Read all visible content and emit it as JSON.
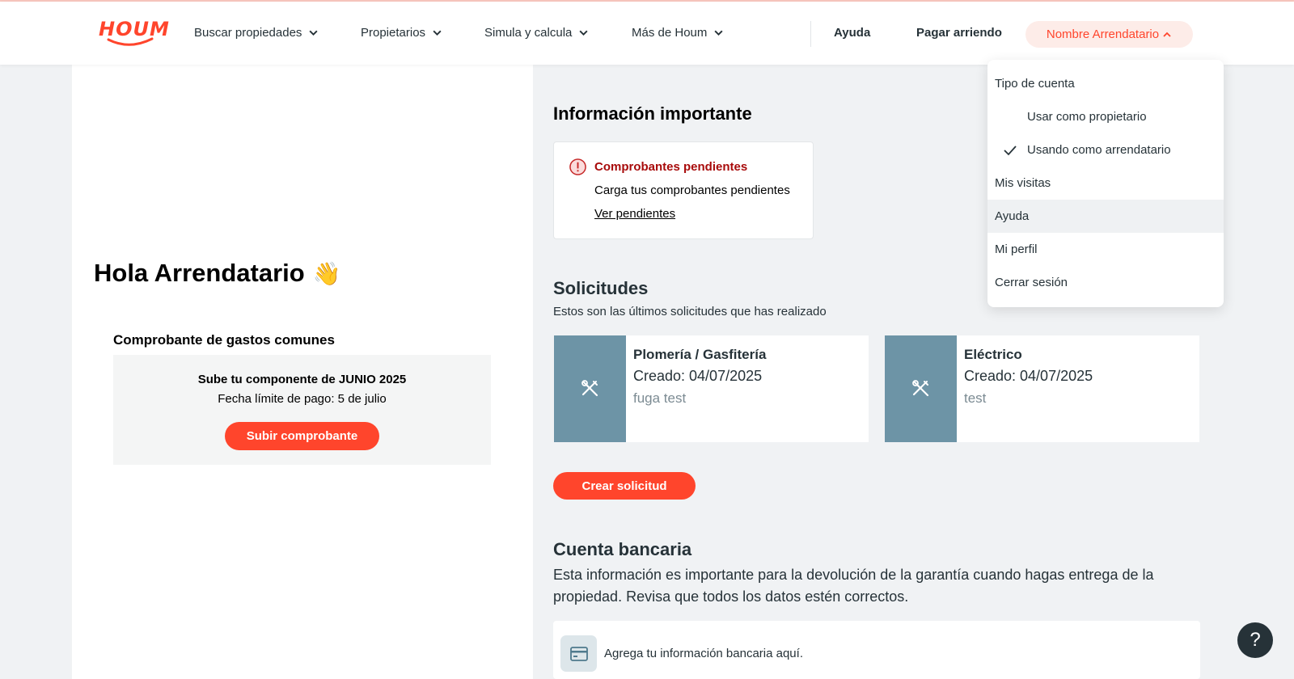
{
  "header": {
    "logo_text": "HOUM",
    "nav": [
      {
        "label": "Buscar propiedades"
      },
      {
        "label": "Propietarios"
      },
      {
        "label": "Simula y calcula"
      },
      {
        "label": "Más de Houm"
      }
    ],
    "help_label": "Ayuda",
    "pay_label": "Pagar arriendo",
    "user_label": "Nombre Arrendatario"
  },
  "dropdown": {
    "section_label": "Tipo de cuenta",
    "account_options": [
      {
        "label": "Usar como propietario",
        "checked": false
      },
      {
        "label": "Usando como arrendatario",
        "checked": true
      }
    ],
    "items": [
      {
        "label": "Mis visitas"
      },
      {
        "label": "Ayuda"
      },
      {
        "label": "Mi perfil"
      },
      {
        "label": "Cerrar sesión"
      }
    ]
  },
  "left": {
    "greeting": "Hola Arrendatario",
    "greeting_emoji": "👋",
    "receipt_title": "Comprobante de gastos comunes",
    "receipt_heading": "Sube tu componente de JUNIO 2025",
    "receipt_date": "Fecha límite de pago: 5 de julio",
    "receipt_button": "Subir comprobante"
  },
  "info": {
    "title": "Información importante",
    "alert_title": "Comprobantes pendientes",
    "alert_text": "Carga tus comprobantes pendientes",
    "alert_link": "Ver pendientes"
  },
  "requests": {
    "title": "Solicitudes",
    "subtitle": "Estos son las últimos solicitudes que has realizado",
    "items": [
      {
        "name": "Plomería / Gasfitería",
        "created": "Creado: 04/07/2025",
        "description": "fuga test"
      },
      {
        "name": "Eléctrico",
        "created": "Creado: 04/07/2025",
        "description": "test"
      }
    ],
    "create_button": "Crear solicitud"
  },
  "bank": {
    "title": "Cuenta bancaria",
    "text": "Esta información es importante para la devolución de la garantía cuando hagas entrega de la propiedad. Revisa que todos los datos estén correctos.",
    "card_label": "Agrega tu información bancaria aquí."
  },
  "help_fab": "?",
  "colors": {
    "accent": "#ff452c",
    "alert": "#a80b0b",
    "request_icon_bg": "#6d94a6",
    "text": "#263238"
  }
}
